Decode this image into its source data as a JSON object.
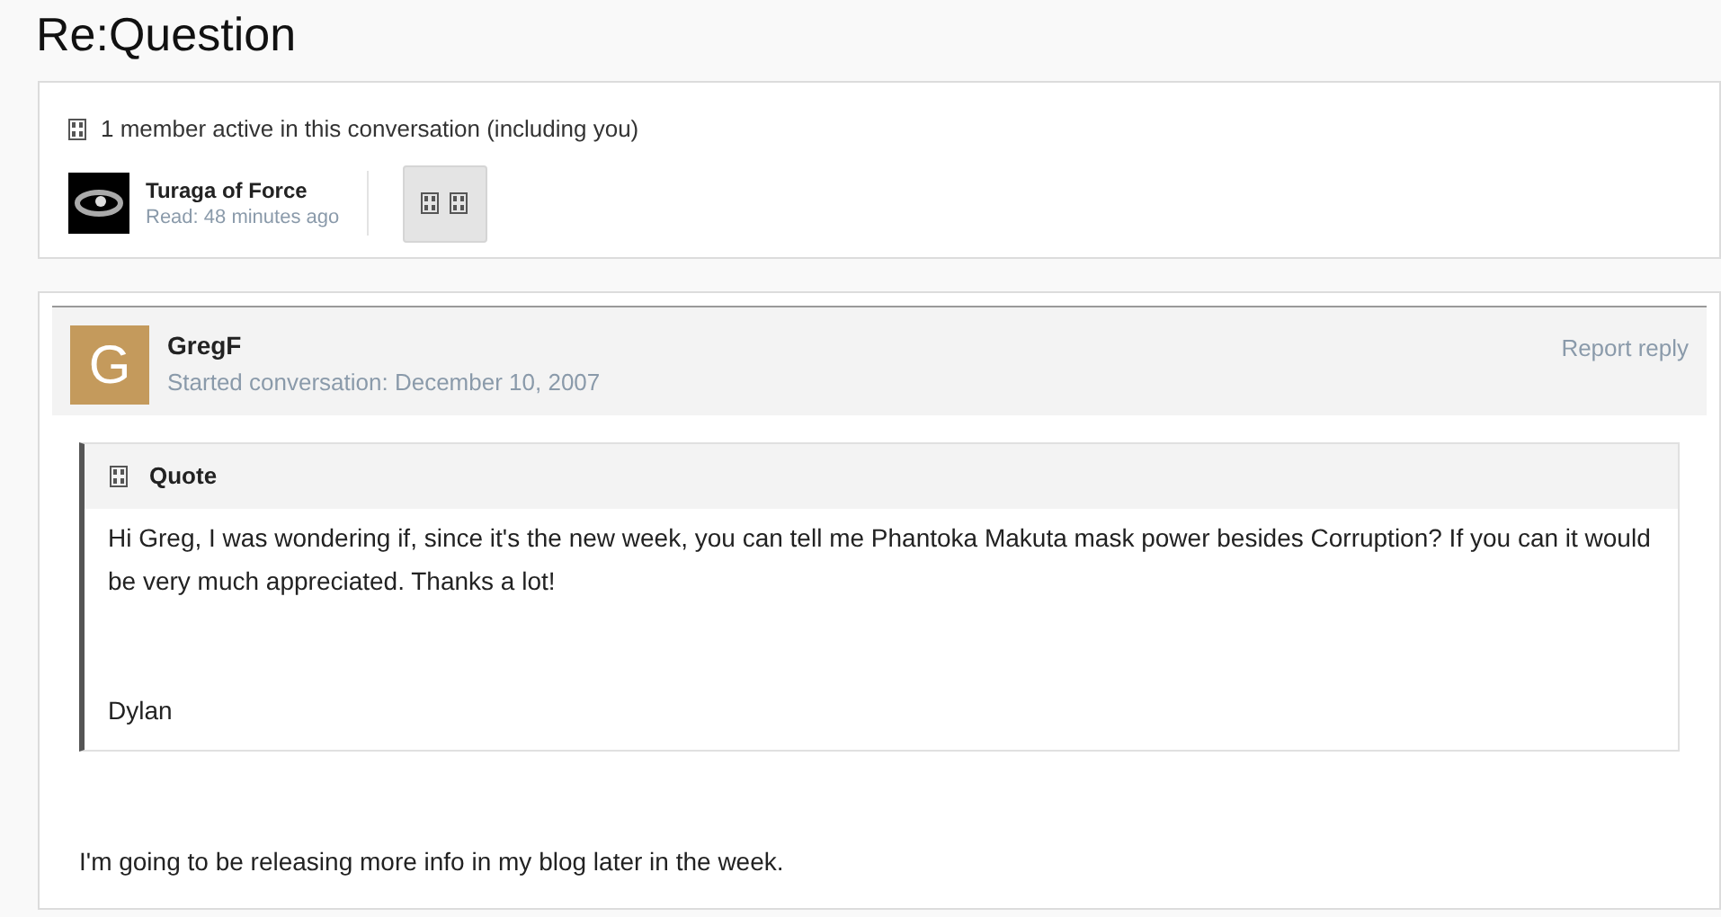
{
  "title": "Re:Question",
  "participants": {
    "summary": "1 member active in this conversation (including you)",
    "members": [
      {
        "name": "Turaga of Force",
        "read": "Read: 48 minutes ago"
      }
    ]
  },
  "message": {
    "author": "GregF",
    "avatar_letter": "G",
    "color": "#c49a5c",
    "started": "Started conversation: December 10, 2007",
    "report": "Report reply",
    "quote": {
      "label": "Quote",
      "paragraphs": [
        "Hi Greg, I was wondering if, since it's the new week, you can tell me Phantoka Makuta mask power besides Corruption? If you can it would be very much appreciated. Thanks a lot!",
        "Dylan"
      ]
    },
    "body": "I'm going to be releasing more info in my blog later in the week."
  }
}
